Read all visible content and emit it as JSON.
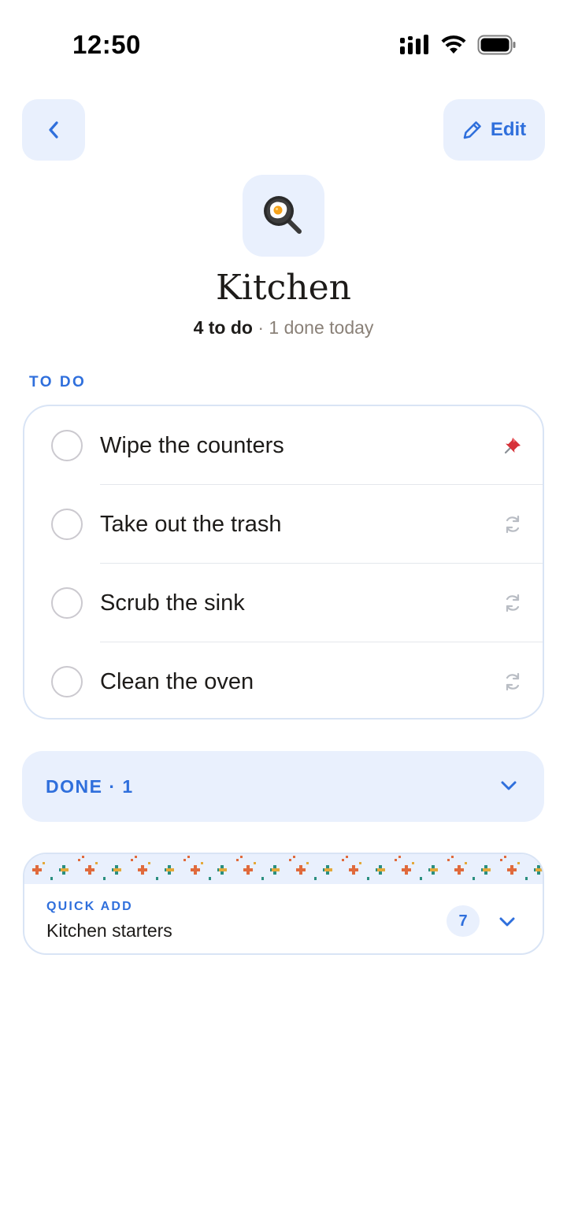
{
  "status_bar": {
    "time": "12:50"
  },
  "nav": {
    "back_icon": "chevron-left-icon",
    "edit_label": "Edit",
    "edit_icon": "pencil-icon"
  },
  "room": {
    "icon": "frying-pan-egg-icon",
    "icon_glyph": "🍳",
    "title": "Kitchen",
    "todo_count": "4 to do",
    "separator": " · ",
    "done_today": "1 done today"
  },
  "todo_section": {
    "label": "TO DO",
    "tasks": [
      {
        "label": "Wipe the counters",
        "trail_icon": "pin-icon",
        "trail_glyph": "📌"
      },
      {
        "label": "Take out the trash",
        "trail_icon": "repeat-icon"
      },
      {
        "label": "Scrub the sink",
        "trail_icon": "repeat-icon"
      },
      {
        "label": "Clean the oven",
        "trail_icon": "repeat-icon"
      }
    ]
  },
  "done_section": {
    "label": "DONE · 1",
    "icon": "chevron-down-icon"
  },
  "quick_add": {
    "label": "QUICK ADD",
    "title": "Kitchen starters",
    "count": "7",
    "icon": "chevron-down-icon"
  },
  "colors": {
    "accent": "#2f6fdc",
    "accent_bg": "#e9f0fd",
    "card_border": "#d9e4f5",
    "muted_text": "#8a8178",
    "pin_red": "#d6333a",
    "pattern_orange": "#e06a3c",
    "pattern_teal": "#2a8f7f",
    "pattern_yellow": "#e3a93a"
  }
}
